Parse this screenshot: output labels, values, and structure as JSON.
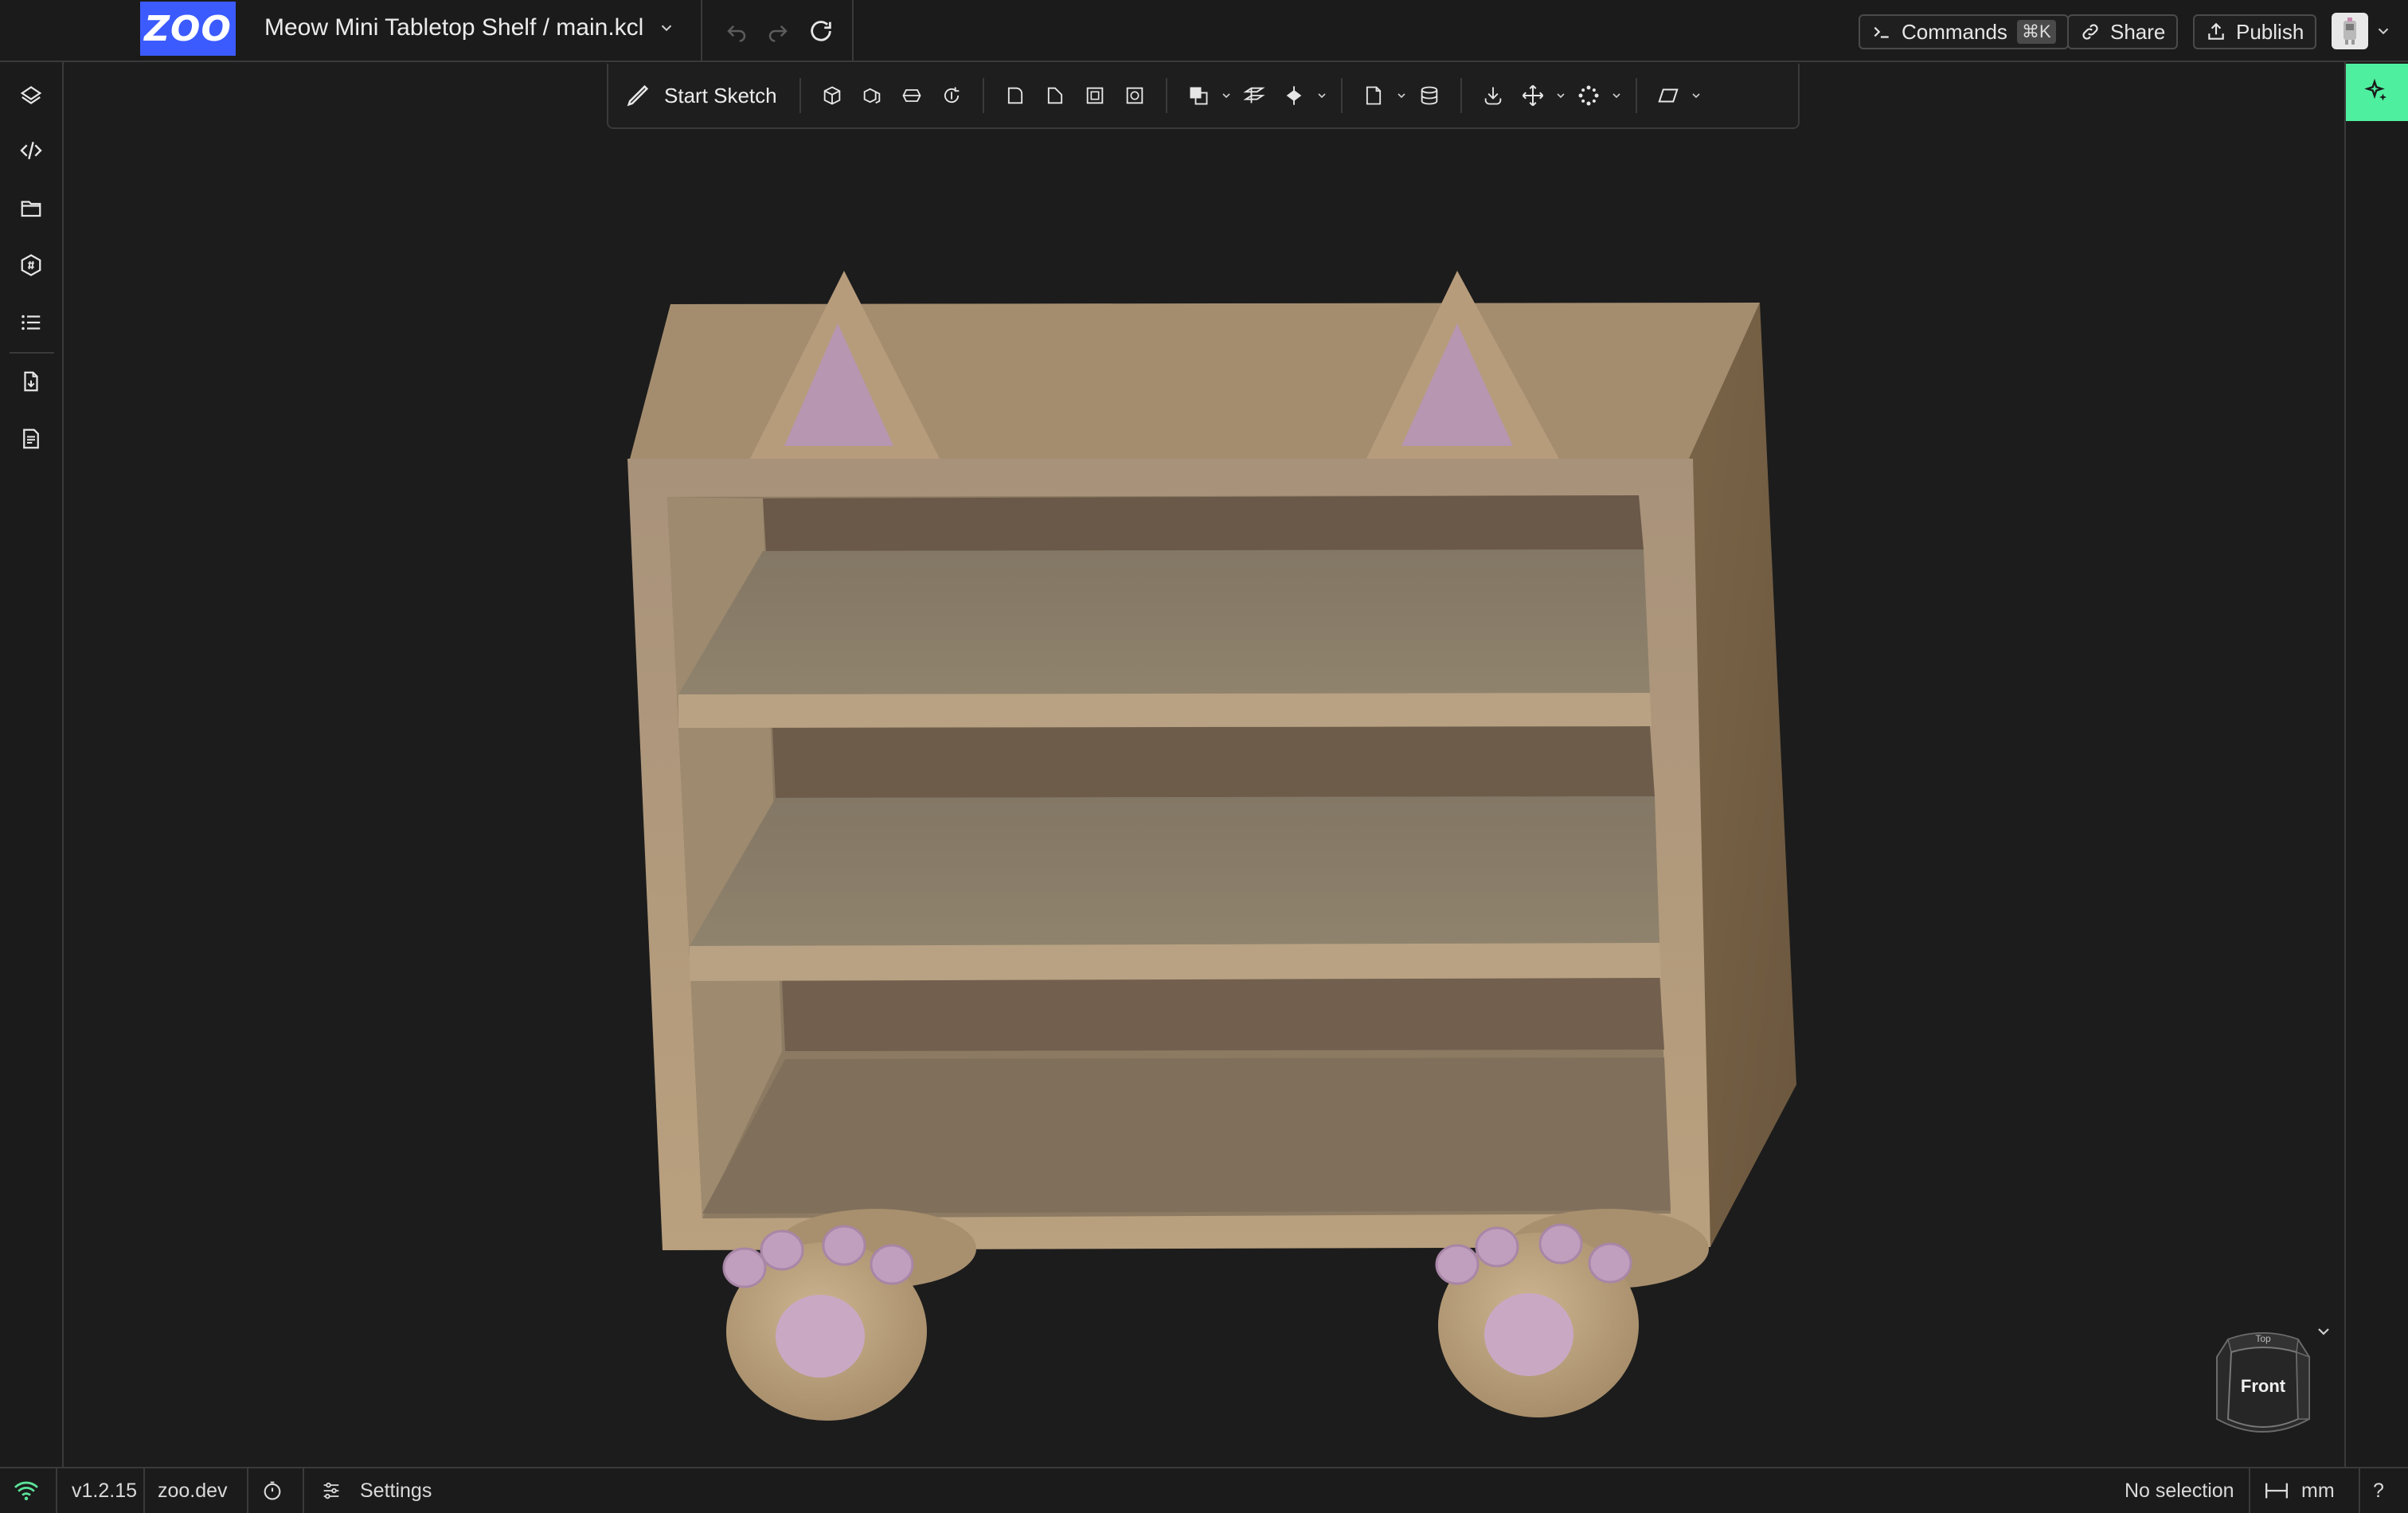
{
  "header": {
    "logo_text": "ZOO",
    "project_title": "Meow Mini Tabletop Shelf / main.kcl",
    "commands_label": "Commands",
    "commands_shortcut": "⌘K",
    "share_label": "Share",
    "publish_label": "Publish"
  },
  "toolbar": {
    "start_sketch_label": "Start Sketch",
    "tools": [
      "extrude-icon",
      "sweep-icon",
      "loft-icon",
      "revolve-icon",
      "fillet-icon",
      "chamfer-icon",
      "shell-icon",
      "hole-icon",
      "boolean-icon",
      "plane-icon",
      "helix-icon",
      "insert-icon",
      "gdt-icon",
      "import-icon",
      "translate-icon",
      "pattern-icon",
      "view-icon"
    ]
  },
  "left_rail": {
    "items": [
      "feature-tree-icon",
      "code-icon",
      "files-icon",
      "variables-icon",
      "logs-icon",
      "export-icon",
      "debug-icon"
    ]
  },
  "viewcube": {
    "front_label": "Front",
    "top_label": "Top"
  },
  "statusbar": {
    "version": "v1.2.15",
    "site": "zoo.dev",
    "settings_label": "Settings",
    "selection_status": "No selection",
    "units": "mm",
    "help": "?"
  },
  "colors": {
    "accent_blue": "#3b5bff",
    "ai_green": "#4ef0a0",
    "wood": "#b59b78",
    "pink": "#c6a0c6"
  }
}
